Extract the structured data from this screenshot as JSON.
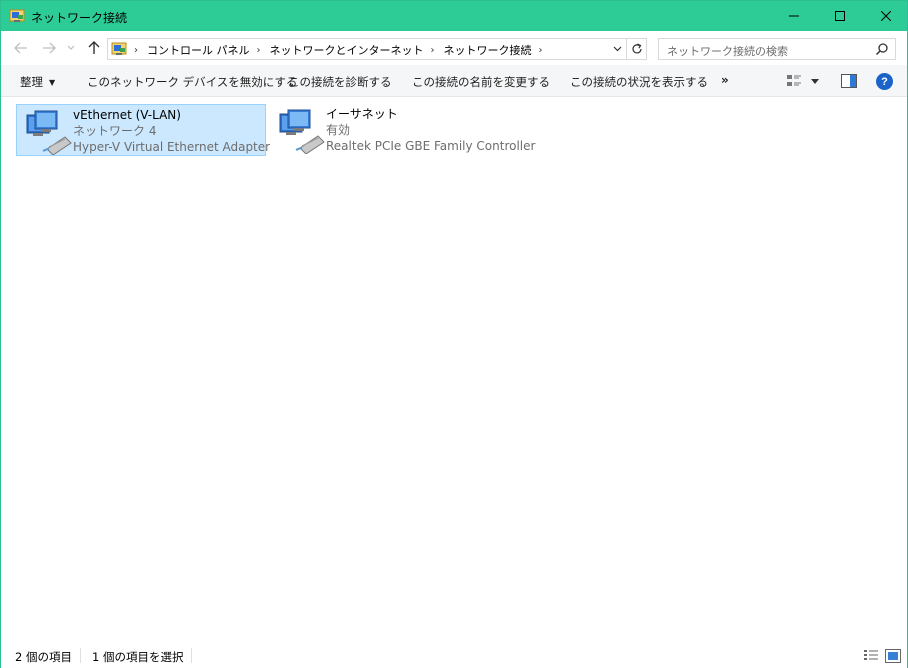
{
  "window": {
    "title": "ネットワーク接続"
  },
  "address": {
    "crumbs": [
      "コントロール パネル",
      "ネットワークとインターネット",
      "ネットワーク接続"
    ],
    "search_placeholder": "ネットワーク接続の検索"
  },
  "commandbar": {
    "organize": "整理",
    "disable": "このネットワーク デバイスを無効にする",
    "diagnose": "この接続を診断する",
    "rename": "この接続の名前を変更する",
    "status": "この接続の状況を表示する",
    "more": "»"
  },
  "items": [
    {
      "name": "vEthernet (V-LAN)",
      "network": "ネットワーク 4",
      "adapter": "Hyper-V Virtual Ethernet Adapter",
      "selected": true
    },
    {
      "name": "イーサネット",
      "network": "有効",
      "adapter": "Realtek PCIe GBE Family Controller",
      "selected": false
    }
  ],
  "status": {
    "count": "2 個の項目",
    "selected": "1 個の項目を選択"
  },
  "colors": {
    "titlebar": "#2dcb96",
    "selection": "#cce8ff",
    "selection_border": "#99d1ff",
    "help": "#1a64c9"
  }
}
